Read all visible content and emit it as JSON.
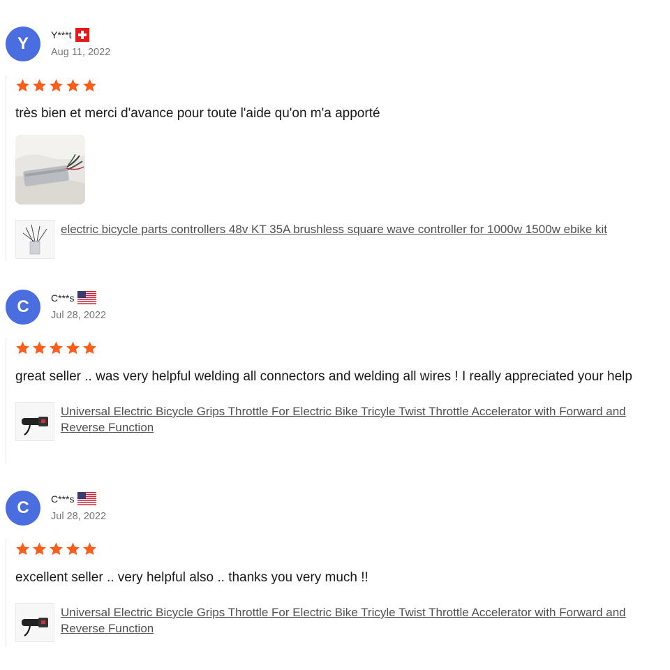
{
  "colors": {
    "avatar": "#4a6ee0",
    "star": "#fd5e1b",
    "link": "#505050",
    "date": "#757575"
  },
  "reviews": [
    {
      "avatar_letter": "Y",
      "user": "Y***t",
      "flag": "switzerland-flag-icon",
      "date": "Aug 11, 2022",
      "rating": 5,
      "text": "très bien et merci d'avance pour toute l'aide qu'on m'a apporté",
      "has_photo": true,
      "product_link": "electric bicycle parts controllers 48v KT 35A brushless square wave controller for 1000w 1500w ebike kit",
      "product_icon": "controller-thumbnail"
    },
    {
      "avatar_letter": "C",
      "user": "C***s",
      "flag": "usa-flag-icon",
      "date": "Jul 28, 2022",
      "rating": 5,
      "text": "great seller .. was very helpful welding all connectors and welding all wires ! I really appreciated your help",
      "has_photo": false,
      "product_link": "Universal Electric Bicycle Grips Throttle For Electric Bike Tricyle Twist Throttle Accelerator with Forward and Reverse Function",
      "product_icon": "throttle-thumbnail"
    },
    {
      "avatar_letter": "C",
      "user": "C***s",
      "flag": "usa-flag-icon",
      "date": "Jul 28, 2022",
      "rating": 5,
      "text": "excellent seller .. very helpful also .. thanks you very much !!",
      "has_photo": false,
      "product_link": "Universal Electric Bicycle Grips Throttle For Electric Bike Tricyle Twist Throttle Accelerator with Forward and Reverse Function",
      "product_icon": "throttle-thumbnail"
    }
  ]
}
